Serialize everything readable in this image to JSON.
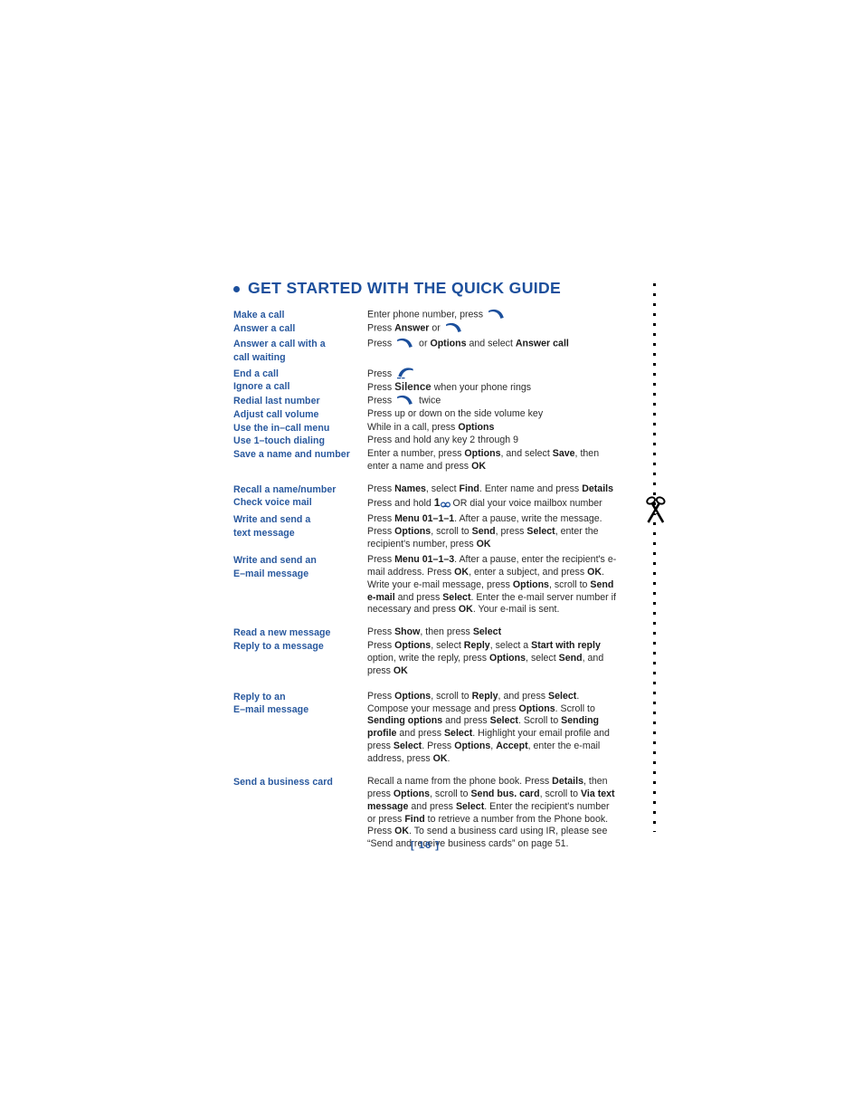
{
  "page": {
    "heading": "GET STARTED WITH THE QUICK GUIDE",
    "page_number": "[ 16 ]",
    "bullet_color": "#1c4f9c",
    "heading_color": "#1c4f9c",
    "label_color": "#28589e",
    "body_color": "#2b2b2b",
    "background_color": "#ffffff"
  },
  "cut_line": {
    "icon": "scissors-icon",
    "orientation": "vertical",
    "style": "dotted"
  },
  "icons": {
    "send_key": "green-call-key-icon",
    "end_key": "end-call-key-icon",
    "voicemail_key": "voicemail-one-key-icon"
  },
  "rows": [
    {
      "label": "Make a call",
      "desc_prefix": "Enter phone number, press ",
      "desc_icon": "send_key",
      "desc_suffix": ""
    },
    {
      "label": "Answer a call",
      "desc_prefix": "Press ",
      "desc_bold_1": "Answer",
      "desc_mid": " or ",
      "desc_icon": "send_key",
      "desc_suffix": ""
    },
    {
      "label": "Answer a call with a call waiting",
      "label_line1": "Answer a call with a",
      "label_line2": "call waiting",
      "desc_prefix": "Press ",
      "desc_icon": "send_key",
      "desc_mid": " or ",
      "desc_bold_1": "Options",
      "desc_mid_2": " and select ",
      "desc_bold_2": "Answer call"
    },
    {
      "label": "End a call",
      "desc_prefix": "Press ",
      "desc_icon": "end_key"
    },
    {
      "label": "Ignore a call",
      "desc_prefix": "Press ",
      "desc_bold_1": "Silence",
      "desc_suffix": " when your phone rings"
    },
    {
      "label": "Redial last number",
      "desc_prefix": "Press ",
      "desc_icon": "send_key",
      "desc_suffix": " twice"
    },
    {
      "label": "Adjust call volume",
      "desc_plain": "Press up or down on the side volume key"
    },
    {
      "label": "Use the in–call menu",
      "desc_prefix": "While in a call, press ",
      "desc_bold_1": "Options"
    },
    {
      "label": "Use 1–touch dialing",
      "desc_plain": "Press and hold any key 2 through 9"
    },
    {
      "label": "Save a name and number",
      "desc_parts": [
        {
          "t": "Enter a number, press "
        },
        {
          "t": "Options",
          "b": true
        },
        {
          "t": ", and select "
        },
        {
          "t": "Save",
          "b": true
        },
        {
          "t": ", then enter a name and press "
        },
        {
          "t": "OK",
          "b": true
        }
      ]
    },
    {
      "label": "Recall a name/number",
      "desc_parts": [
        {
          "t": "Press "
        },
        {
          "t": "Names",
          "b": true
        },
        {
          "t": ", select "
        },
        {
          "t": "Find",
          "b": true
        },
        {
          "t": ". Enter name and press "
        },
        {
          "t": "Details",
          "b": true
        }
      ]
    },
    {
      "label": "Check voice mail",
      "desc_vm_prefix": "Press and hold ",
      "desc_vm_suffix": " OR dial your voice mailbox number"
    },
    {
      "label": "Write and send a text message",
      "label_line1": "Write and send a",
      "label_line2": "text message",
      "desc_parts": [
        {
          "t": "Press "
        },
        {
          "t": "Menu 01–1–1",
          "b": true
        },
        {
          "t": ". After a pause, write the message. Press "
        },
        {
          "t": "Options",
          "b": true
        },
        {
          "t": ", scroll to "
        },
        {
          "t": "Send",
          "b": true
        },
        {
          "t": ", press "
        },
        {
          "t": "Select",
          "b": true
        },
        {
          "t": ", enter the recipient's number, press "
        },
        {
          "t": "OK",
          "b": true
        }
      ]
    },
    {
      "label": "Write and send an E–mail message",
      "label_line1": "Write and send an",
      "label_line2": "E–mail message",
      "desc_parts": [
        {
          "t": "Press "
        },
        {
          "t": "Menu 01–1–3",
          "b": true
        },
        {
          "t": ". After a pause, enter the recipient's e-mail address. Press "
        },
        {
          "t": "OK",
          "b": true
        },
        {
          "t": ", enter a subject, and press "
        },
        {
          "t": "OK",
          "b": true
        },
        {
          "t": ". Write your e-mail message, press "
        },
        {
          "t": "Options",
          "b": true
        },
        {
          "t": ", scroll to "
        },
        {
          "t": "Send e-mail",
          "b": true
        },
        {
          "t": " and press "
        },
        {
          "t": "Select",
          "b": true
        },
        {
          "t": ". Enter the e-mail server number if necessary and press "
        },
        {
          "t": "OK",
          "b": true
        },
        {
          "t": ". Your e-mail is sent."
        }
      ]
    },
    {
      "label": "Read a new message",
      "desc_parts": [
        {
          "t": "Press "
        },
        {
          "t": "Show",
          "b": true
        },
        {
          "t": ", then press "
        },
        {
          "t": "Select",
          "b": true
        }
      ]
    },
    {
      "label": "Reply to a message",
      "desc_parts": [
        {
          "t": "Press "
        },
        {
          "t": "Options",
          "b": true
        },
        {
          "t": ", select "
        },
        {
          "t": "Reply",
          "b": true
        },
        {
          "t": ", select a "
        },
        {
          "t": "Start with reply",
          "b": true
        },
        {
          "t": " option, write the reply, press "
        },
        {
          "t": "Options",
          "b": true
        },
        {
          "t": ", select "
        },
        {
          "t": "Send",
          "b": true
        },
        {
          "t": ", and press "
        },
        {
          "t": "OK",
          "b": true
        }
      ]
    },
    {
      "label": "Reply to an E–mail message",
      "label_line1": "Reply to an",
      "label_line2": "E–mail message",
      "desc_parts": [
        {
          "t": "Press "
        },
        {
          "t": "Options",
          "b": true
        },
        {
          "t": ", scroll to "
        },
        {
          "t": "Reply",
          "b": true
        },
        {
          "t": ", and press "
        },
        {
          "t": "Select",
          "b": true
        },
        {
          "t": ". Compose your message and press "
        },
        {
          "t": "Options",
          "b": true
        },
        {
          "t": ". Scroll to "
        },
        {
          "t": "Sending options",
          "b": true
        },
        {
          "t": " and press "
        },
        {
          "t": "Select",
          "b": true
        },
        {
          "t": ". Scroll to "
        },
        {
          "t": "Sending profile",
          "b": true
        },
        {
          "t": " and press "
        },
        {
          "t": "Select",
          "b": true
        },
        {
          "t": ". Highlight your email profile and press "
        },
        {
          "t": "Select",
          "b": true
        },
        {
          "t": ". Press "
        },
        {
          "t": "Options",
          "b": true
        },
        {
          "t": ", "
        },
        {
          "t": "Accept",
          "b": true
        },
        {
          "t": ", enter the e-mail address, press "
        },
        {
          "t": "OK",
          "b": true
        },
        {
          "t": "."
        }
      ]
    },
    {
      "label": "Send a business card",
      "desc_parts": [
        {
          "t": "Recall a name from the phone book. Press "
        },
        {
          "t": "Details",
          "b": true
        },
        {
          "t": ", then press "
        },
        {
          "t": "Options",
          "b": true
        },
        {
          "t": ", scroll to "
        },
        {
          "t": "Send bus. card",
          "b": true
        },
        {
          "t": ", scroll to "
        },
        {
          "t": "Via text message",
          "b": true
        },
        {
          "t": " and press "
        },
        {
          "t": "Select",
          "b": true
        },
        {
          "t": ". Enter the recipient's number or press "
        },
        {
          "t": "Find",
          "b": true
        },
        {
          "t": " to retrieve a number from the Phone book. Press "
        },
        {
          "t": "OK",
          "b": true
        },
        {
          "t": ". To send a business card using IR, please see “Send and receive business cards” on page 51."
        }
      ]
    }
  ]
}
